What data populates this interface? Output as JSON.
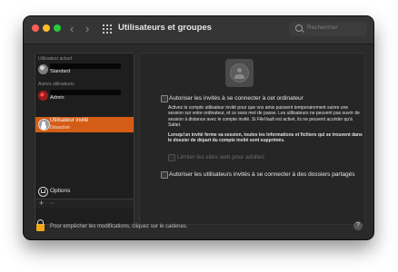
{
  "window": {
    "title": "Utilisateurs et groupes"
  },
  "toolbar": {
    "back": "‹",
    "forward": "›"
  },
  "search": {
    "placeholder": "Rechercher"
  },
  "sidebar": {
    "current_user_section": "Utilisateur actuel",
    "current_user": {
      "role": "Standard"
    },
    "other_users_section": "Autres utilisateurs",
    "other_user": {
      "role": "Admin"
    },
    "guest": {
      "name": "Utilisateur invité",
      "status": "Désactivé"
    },
    "options_label": "Options",
    "add": "+",
    "remove": "−"
  },
  "panel": {
    "allow_guests_label": "Autoriser les invités à se connecter à cet ordinateur",
    "allow_guests_desc": "Activez le compte utilisateur invité pour que vos amis puissent temporairement suivre une session sur votre ordinateur, et ce sans mot de passe. Les utilisateurs ne peuvent pas ouvrir de session à distance avec le compte invité. Si FileVault est activé, ils ne peuvent accéder qu'à Safari.",
    "warning": "Lorsqu'un invité ferme sa session, toutes les informations et fichiers qui se trouvent dans le dossier de départ du compte invité sont supprimés.",
    "limit_sites_label": "Limiter les sites web pour adultes",
    "shared_folders_label": "Autoriser les utilisateurs invités à se connecter à des dossiers partagés"
  },
  "footer": {
    "lock_text": "Pour empêcher les modifications, cliquez sur le cadenas.",
    "help": "?"
  },
  "colors": {
    "selection": "#d35d16",
    "window_bg": "#2a2a2a",
    "lock": "#f0a71a"
  }
}
